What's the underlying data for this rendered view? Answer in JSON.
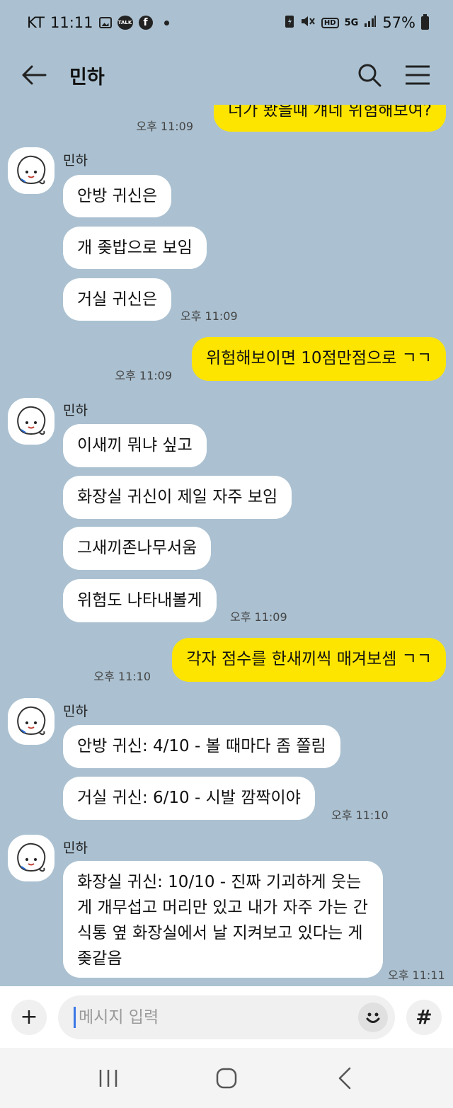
{
  "status_bar": {
    "carrier": "KT",
    "time": "11:11",
    "talk_label": "TALK",
    "hd_label": "HD",
    "network": "5G",
    "battery": "57%"
  },
  "header": {
    "title": "민하"
  },
  "messages": [
    {
      "type": "sent",
      "text": "너가 봤을때 걔네 위험해보여?",
      "time": "오후 11:09"
    },
    {
      "type": "sender",
      "name": "민하"
    },
    {
      "type": "recv",
      "text": "안방 귀신은"
    },
    {
      "type": "recv",
      "text": "개 좆밥으로 보임"
    },
    {
      "type": "recv",
      "text": "거실 귀신은",
      "time": "오후 11:09"
    },
    {
      "type": "sent",
      "text": "위험해보이면 10점만점으로 ㄱㄱ",
      "time": "오후 11:09"
    },
    {
      "type": "sender",
      "name": "민하"
    },
    {
      "type": "recv",
      "text": "이새끼 뭐냐 싶고"
    },
    {
      "type": "recv",
      "text": "화장실 귀신이 제일 자주 보임"
    },
    {
      "type": "recv",
      "text": "그새끼존나무서움"
    },
    {
      "type": "recv",
      "text": "위험도 나타내볼게",
      "time": "오후 11:09"
    },
    {
      "type": "sent",
      "text": "각자 점수를 한새끼씩 매겨보셈 ㄱㄱ",
      "time": "오후 11:10"
    },
    {
      "type": "sender",
      "name": "민하"
    },
    {
      "type": "recv",
      "text": "안방 귀신: 4/10 - 볼 때마다 좀 쫄림"
    },
    {
      "type": "recv",
      "text": "거실 귀신: 6/10 - 시발 깜짝이야",
      "time": "오후 11:10"
    },
    {
      "type": "sender",
      "name": "민하"
    },
    {
      "type": "recv",
      "text": "화장실 귀신: 10/10 - 진짜 기괴하게 웃는 게 개무섭고 머리만 있고 내가 자주 가는 간식통 옆 화장실에서 날 지켜보고 있다는 게 좆같음",
      "time": "오후 11:11"
    }
  ],
  "input": {
    "placeholder": "메시지 입력",
    "plus_label": "+",
    "hash_label": "#"
  }
}
